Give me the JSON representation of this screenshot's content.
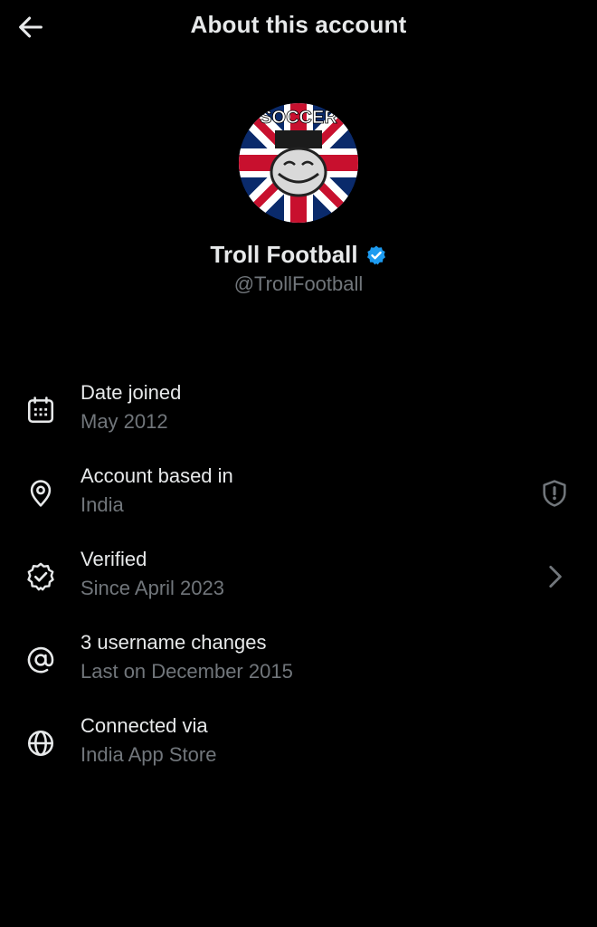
{
  "header": {
    "title": "About this account",
    "back_icon": "arrow-left-icon"
  },
  "profile": {
    "name": "Troll Football",
    "handle": "@TrollFootball",
    "verified_badge_color": "#1d9bf0",
    "avatar_text_top": "SOCCER",
    "avatar_colors": {
      "blue": "#0a2a6b",
      "red": "#c8102e",
      "white": "#ffffff"
    }
  },
  "rows": [
    {
      "label": "Date joined",
      "value": "May 2012",
      "icon": "calendar-icon"
    },
    {
      "label": "Account based in",
      "value": "India",
      "icon": "location-pin-icon",
      "right_icon": "shield-alert-icon"
    },
    {
      "label": "Verified",
      "value": "Since April 2023",
      "icon": "verified-badge-icon",
      "right_icon": "chevron-right-icon"
    },
    {
      "label": "3 username changes",
      "value": "Last on December 2015",
      "icon": "at-sign-icon"
    },
    {
      "label": "Connected via",
      "value": "India App Store",
      "icon": "globe-icon"
    }
  ],
  "colors": {
    "background": "#000000",
    "primary_text": "#e7e9ea",
    "secondary_text": "#71767b",
    "accent": "#1d9bf0"
  }
}
